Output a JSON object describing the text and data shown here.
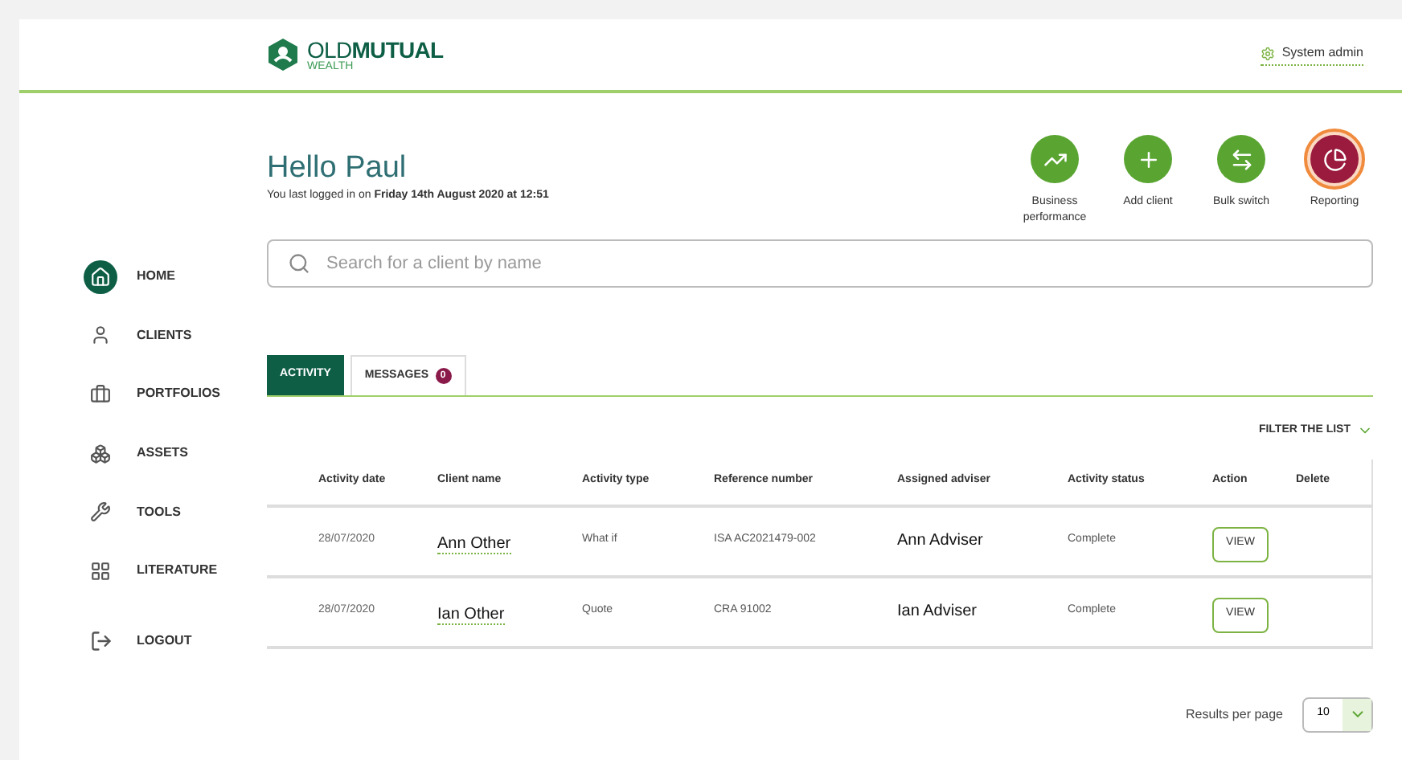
{
  "header": {
    "logo": {
      "bold_part": "OLD",
      "strong_part": "MUTUAL",
      "sub": "WEALTH"
    },
    "user_link": "System admin"
  },
  "greeting": {
    "title": "Hello Paul",
    "last_login": "You last logged in on **Friday 14th August 2020 at 12:51**"
  },
  "actions": [
    {
      "kind": "chart",
      "label": "Business performance",
      "selected": false
    },
    {
      "kind": "add",
      "label": "Add client",
      "selected": false
    },
    {
      "kind": "switch",
      "label": "Bulk switch",
      "selected": false
    },
    {
      "kind": "report",
      "label": "Reporting",
      "selected": true
    }
  ],
  "sidebar": {
    "items": [
      {
        "kind": "home",
        "label": "HOME",
        "selected": true
      },
      {
        "kind": "clients",
        "label": "CLIENTS",
        "selected": false
      },
      {
        "kind": "portfolios",
        "label": "PORTFOLIOS",
        "selected": false
      },
      {
        "kind": "assets",
        "label": "ASSETS",
        "selected": false
      },
      {
        "kind": "tools",
        "label": "TOOLS",
        "selected": false
      },
      {
        "kind": "literature",
        "label": "LITERATURE",
        "selected": false
      }
    ],
    "logout": "LOGOUT"
  },
  "search": {
    "placeholder": "Search for a client by name"
  },
  "tabs": [
    {
      "label": "ACTIVITY",
      "selected": true
    },
    {
      "label": "MESSAGES",
      "count": "0",
      "selected": false
    }
  ],
  "filter": "FILTER THE LIST",
  "table": {
    "columns": [
      "Activity date",
      "Client name",
      "Activity type",
      "Reference number",
      "Assigned adviser",
      "Activity status",
      "Action",
      "Delete"
    ],
    "rows": [
      {
        "date": "28/07/2020",
        "client": "Ann Other",
        "type": "What if",
        "reference": "ISA AC2021479-002",
        "adviser": "Ann Adviser",
        "status": "Complete",
        "action": "VIEW"
      },
      {
        "date": "28/07/2020",
        "client": "Ian Other",
        "type": "Quote",
        "reference": "CRA 91002",
        "adviser": "Ian Adviser",
        "status": "Complete",
        "action": "VIEW"
      }
    ]
  },
  "pagination": {
    "label": "Results per page",
    "value": "10"
  }
}
